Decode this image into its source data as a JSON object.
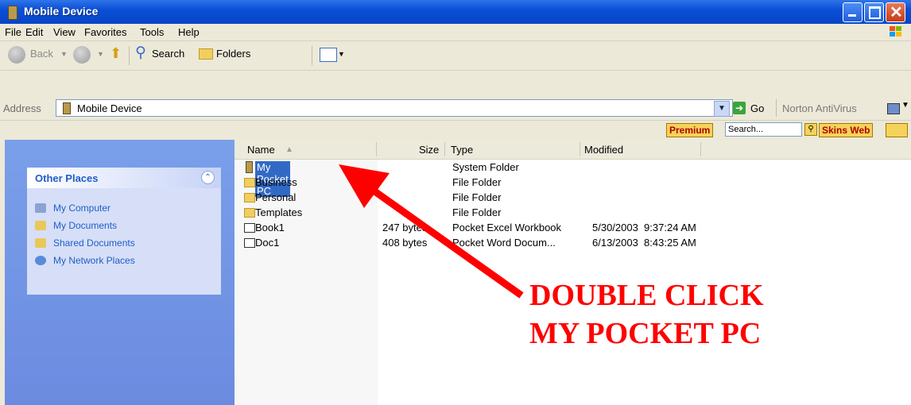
{
  "window": {
    "title": "Mobile Device"
  },
  "menu": [
    "File",
    "Edit",
    "View",
    "Favorites",
    "Tools",
    "Help"
  ],
  "toolbar": {
    "back": "Back",
    "search": "Search",
    "folders": "Folders"
  },
  "address": {
    "label": "Address",
    "value": "Mobile Device",
    "go": "Go",
    "norton": "Norton AntiVirus"
  },
  "linkbar": {
    "premium": "Premium",
    "search_value": "Search...",
    "skins_web": "Skins Web"
  },
  "sidebar": {
    "title": "Other Places",
    "items": [
      "My Computer",
      "My Documents",
      "Shared Documents",
      "My Network Places"
    ]
  },
  "columns": {
    "name": "Name",
    "size": "Size",
    "type": "Type",
    "modified": "Modified"
  },
  "files": [
    {
      "name": "My Pocket PC",
      "size": "",
      "type": "System Folder",
      "modified": ""
    },
    {
      "name": "Business",
      "size": "",
      "type": "File Folder",
      "modified": ""
    },
    {
      "name": "Personal",
      "size": "",
      "type": "File Folder",
      "modified": ""
    },
    {
      "name": "Templates",
      "size": "",
      "type": "File Folder",
      "modified": ""
    },
    {
      "name": "Book1",
      "size": "247 bytes",
      "type": "Pocket Excel Workbook",
      "modified": "5/30/2003  9:37:24 AM"
    },
    {
      "name": "Doc1",
      "size": "408 bytes",
      "type": "Pocket Word Docum...",
      "modified": "6/13/2003  8:43:25 AM"
    }
  ],
  "annotation": {
    "line1": "DOUBLE CLICK",
    "line2": "MY POCKET PC",
    "color": "#ff0000"
  }
}
